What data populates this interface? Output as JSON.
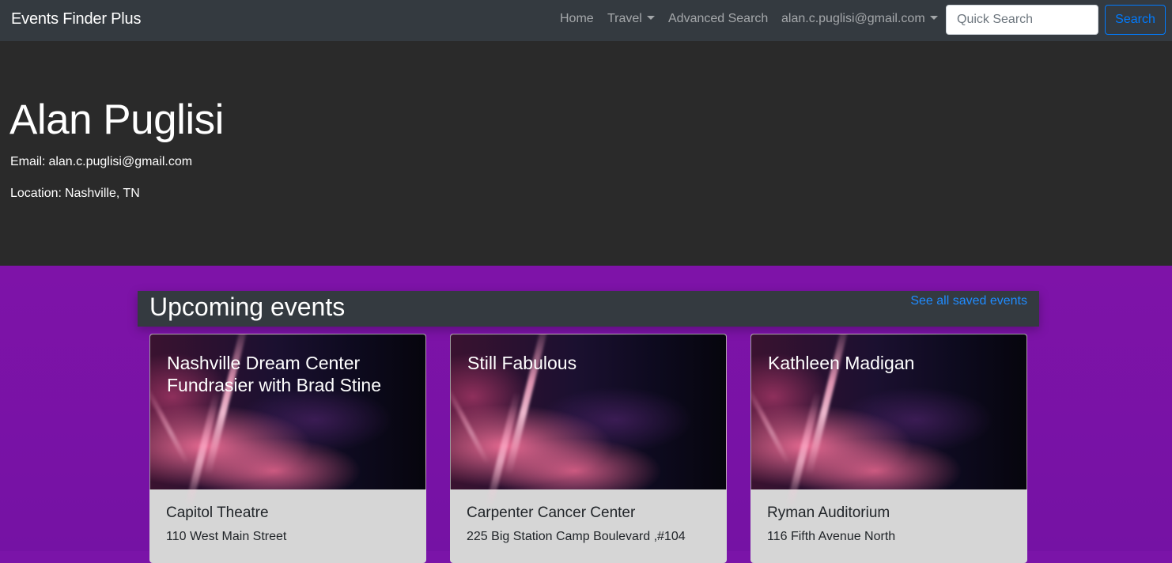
{
  "navbar": {
    "brand": "Events Finder Plus",
    "links": {
      "home": "Home",
      "travel": "Travel",
      "advanced_search": "Advanced Search",
      "user": "alan.c.puglisi@gmail.com"
    },
    "search": {
      "placeholder": "Quick Search",
      "value": "",
      "button_label": "Search"
    }
  },
  "profile": {
    "name": "Alan Puglisi",
    "email_label": "Email:",
    "email": "alan.c.puglisi@gmail.com",
    "location_label": "Location:",
    "location": "Nashville, TN"
  },
  "events": {
    "heading": "Upcoming events",
    "see_all_label": "See all saved events",
    "cards": [
      {
        "title": "Nashville Dream Center Fundrasier with Brad Stine",
        "venue": "Capitol Theatre",
        "address": "110 West Main Street"
      },
      {
        "title": "Still Fabulous",
        "venue": "Carpenter Cancer Center",
        "address": "225 Big Station Camp Boulevard ,#104"
      },
      {
        "title": "Kathleen Madigan",
        "venue": "Ryman Auditorium",
        "address": "116 Fifth Avenue North"
      }
    ]
  },
  "colors": {
    "navbar_bg": "#343a40",
    "hero_bg": "#2a2a2a",
    "page_bg": "#7a14a8",
    "link_accent": "#007bff",
    "card_body_bg": "#d6d6d6"
  }
}
